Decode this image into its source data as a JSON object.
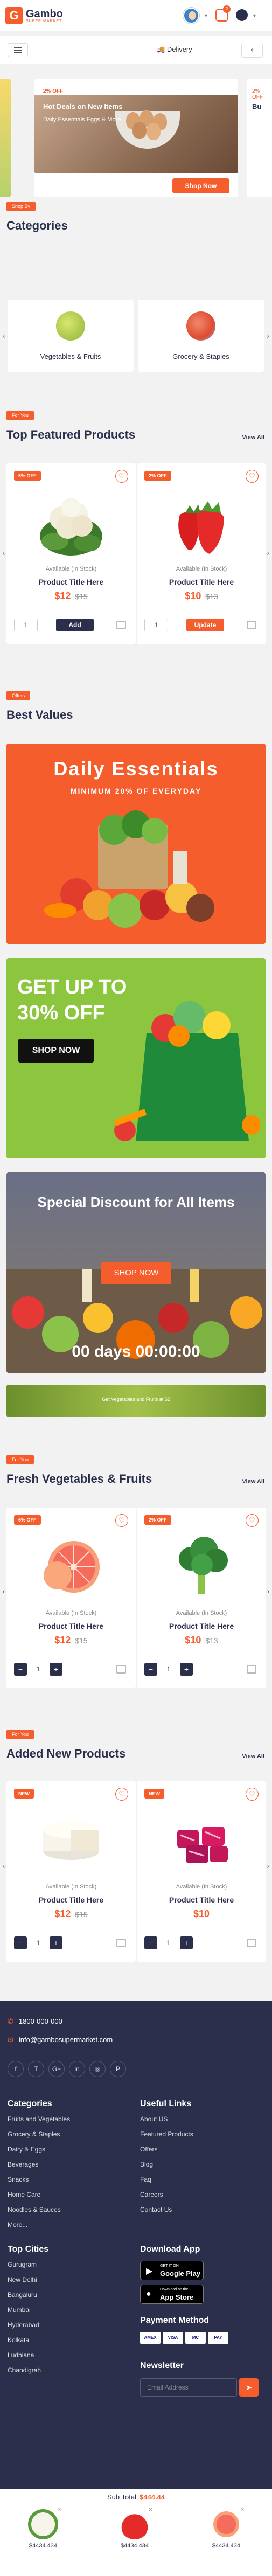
{
  "header": {
    "logo_letter": "G",
    "logo_name": "Gambo",
    "logo_tagline": "SUPER MARKET",
    "cart_count": "2"
  },
  "subheader": {
    "delivery_label": "Delivery",
    "location_label": "Loc"
  },
  "deal": {
    "off": "2% OFF",
    "title": "Hot Deals on New Items",
    "subtitle": "Daily Essentials Eggs & More",
    "button": "Shop Now",
    "side_off": "2% OFF",
    "side_title": "Bu"
  },
  "categories": {
    "label": "Shop By",
    "title": "Categories",
    "items": [
      {
        "name": "Vegetables & Fruits"
      },
      {
        "name": "Grocery & Staples"
      }
    ]
  },
  "featured": {
    "label": "For You",
    "title": "Top Featured Products",
    "view_all": "View All",
    "products": [
      {
        "badge": "6% OFF",
        "stock": "Available (In Stock)",
        "title": "Product Title Here",
        "price": "$12",
        "old_price": "$15",
        "qty": "1",
        "button": "Add"
      },
      {
        "badge": "2% OFF",
        "stock": "Available (In Stock)",
        "title": "Product Title Here",
        "price": "$10",
        "old_price": "$13",
        "qty": "1",
        "button": "Update"
      }
    ]
  },
  "offers": {
    "label": "Offers",
    "title": "Best Values",
    "banner1": {
      "title": "Daily Essentials",
      "subtitle": "MINIMUM 20% OF EVERYDAY"
    },
    "banner2": {
      "title": "GET UP TO 30% OFF",
      "button": "SHOP NOW"
    },
    "banner3": {
      "title": "Special Discount for All Items",
      "button": "SHOP NOW",
      "timer": "00 days 00:00:00"
    },
    "banner4": {
      "text": "Get Vegetables and Fruits at $2"
    }
  },
  "fresh": {
    "label": "For You",
    "title": "Fresh Vegetables & Fruits",
    "view_all": "View All",
    "products": [
      {
        "badge": "6% OFF",
        "stock": "Available (In Stock)",
        "title": "Product Title Here",
        "price": "$12",
        "old_price": "$15",
        "qty": "1"
      },
      {
        "badge": "2% OFF",
        "stock": "Available (In Stock)",
        "title": "Product Title Here",
        "price": "$10",
        "old_price": "$13",
        "qty": "1"
      }
    ]
  },
  "added": {
    "label": "For You",
    "title": "Added New Products",
    "view_all": "View All",
    "products": [
      {
        "badge": "NEW",
        "stock": "Available (In Stock)",
        "title": "Product Title Here",
        "price": "$12",
        "old_price": "$15",
        "qty": "1"
      },
      {
        "badge": "NEW",
        "stock": "Available (In Stock)",
        "title": "Product Title Here",
        "price": "$10",
        "old_price": "",
        "qty": "1"
      }
    ]
  },
  "footer": {
    "phone": "1800-000-000",
    "email": "info@gambosupermarket.com",
    "social": [
      "f",
      "T",
      "G+",
      "in",
      "◎",
      "P"
    ],
    "categories_title": "Categories",
    "categories": [
      "Fruits and Vegetables",
      "Grocery & Staples",
      "Dairy & Eggs",
      "Beverages",
      "Snacks",
      "Home Care",
      "Noodles & Sauces",
      "More..."
    ],
    "links_title": "Useful Links",
    "links": [
      "About US",
      "Featured Products",
      "Offers",
      "Blog",
      "Faq",
      "Careers",
      "Contact Us"
    ],
    "cities_title": "Top Cities",
    "cities": [
      "Gurugram",
      "New Delhi",
      "Bangaluru",
      "Mumbai",
      "Hyderabad",
      "Kolkata",
      "Ludhiana",
      "Chandigrah"
    ],
    "app_title": "Download App",
    "google_small": "GET IT ON",
    "google_big": "Google Play",
    "apple_small": "Download on the",
    "apple_big": "App Store",
    "payment_title": "Payment Method",
    "payments": [
      "AMEX",
      "VISA",
      "MC",
      "PAY"
    ],
    "newsletter_title": "Newsletter",
    "newsletter_placeholder": "Email Address"
  },
  "bottom": {
    "subtotal_label": "Sub Total",
    "subtotal_value": "$444.44",
    "items": [
      {
        "price": "$4434.434"
      },
      {
        "price": "$4434.434"
      },
      {
        "price": "$4434.434"
      }
    ]
  },
  "colors": {
    "accent": "#f55d2c",
    "navy": "#2b2f4c",
    "green": "#8cc63f"
  }
}
